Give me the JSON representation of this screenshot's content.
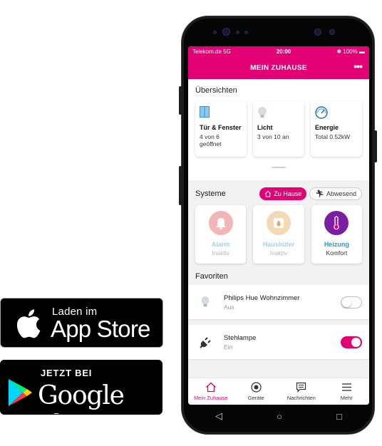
{
  "badges": {
    "apple": {
      "small": "Laden im",
      "big": "App Store"
    },
    "google": {
      "small": "JETZT BEI",
      "big": "Google play"
    }
  },
  "status": {
    "carrier": "Telekom.de 5G",
    "time": "20:00",
    "battery": "100%"
  },
  "header": {
    "title": "MEIN ZUHAUSE",
    "more": "•••"
  },
  "overview": {
    "title": "Übersichten",
    "cards": [
      {
        "name": "Tür & Fenster",
        "value": "4 von 6 geöffnet",
        "icon": "door-window-icon"
      },
      {
        "name": "Licht",
        "value": "3 von 10 an",
        "icon": "bulb-icon"
      },
      {
        "name": "Energie",
        "value": "Total 0.52kW",
        "icon": "gauge-icon"
      }
    ]
  },
  "systems": {
    "title": "Systeme",
    "mode_home": "Zu Hause",
    "mode_away": "Abwesend",
    "cards": [
      {
        "name": "Alarm",
        "state": "Inaktiv",
        "icon": "bell-icon",
        "color": "#f0b4b4",
        "textColor": "#a9d8ee"
      },
      {
        "name": "Haushüter",
        "state": "Inaktiv",
        "icon": "house-sitter-icon",
        "color": "#f3dcb8",
        "textColor": "#a9d8ee"
      },
      {
        "name": "Heizung",
        "state": "Komfort",
        "icon": "thermometer-icon",
        "color": "#7b1fa2",
        "textColor": "#1e9ad6"
      }
    ]
  },
  "favorites": {
    "title": "Favoriten",
    "items": [
      {
        "name": "Philips Hue Wohnzimmer",
        "state": "Aus",
        "on": false,
        "icon": "bulb-icon"
      },
      {
        "name": "Stehlampe",
        "state": "Ein",
        "on": true,
        "icon": "plug-icon"
      }
    ]
  },
  "tabs": [
    {
      "label": "Mein Zuhause",
      "icon": "home-icon",
      "active": true
    },
    {
      "label": "Geräte",
      "icon": "devices-icon",
      "active": false
    },
    {
      "label": "Nachrichten",
      "icon": "messages-icon",
      "active": false
    },
    {
      "label": "Mehr",
      "icon": "menu-icon",
      "active": false
    }
  ],
  "navbar": {
    "back": "◁",
    "home": "○",
    "recent": "□"
  },
  "colors": {
    "accent": "#e20074"
  }
}
